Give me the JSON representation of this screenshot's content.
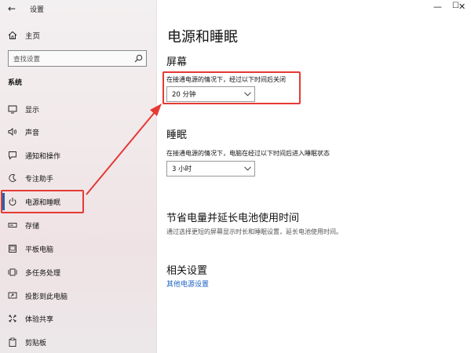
{
  "window": {
    "back": "←",
    "title": "设置",
    "controls": [
      "—",
      "☐",
      "✕"
    ]
  },
  "sidebar": {
    "home_label": "主页",
    "search_placeholder": "查找设置",
    "section_label": "系统",
    "items": [
      {
        "label": "显示",
        "icon": "display-icon"
      },
      {
        "label": "声音",
        "icon": "sound-icon"
      },
      {
        "label": "通知和操作",
        "icon": "notifications-icon"
      },
      {
        "label": "专注助手",
        "icon": "focus-assist-icon"
      },
      {
        "label": "电源和睡眠",
        "icon": "power-icon",
        "active": true
      },
      {
        "label": "存储",
        "icon": "storage-icon"
      },
      {
        "label": "平板电脑",
        "icon": "tablet-icon"
      },
      {
        "label": "多任务处理",
        "icon": "multitasking-icon"
      },
      {
        "label": "投影到此电脑",
        "icon": "project-icon"
      },
      {
        "label": "体验共享",
        "icon": "shared-experiences-icon"
      },
      {
        "label": "剪贴板",
        "icon": "clipboard-icon"
      }
    ]
  },
  "main": {
    "title": "电源和睡眠",
    "screen": {
      "heading": "屏幕",
      "desc": "在接通电源的情况下，经过以下时间后关闭",
      "value": "20 分钟"
    },
    "sleep": {
      "heading": "睡眠",
      "desc": "在接通电源的情况下，电脑在经过以下时间后进入睡眠状态",
      "value": "3 小时"
    },
    "battery": {
      "heading": "节省电量并延长电池使用时间",
      "desc": "通过选择更短的屏幕显示时长和睡眠设置，延长电池使用时间。"
    },
    "related": {
      "heading": "相关设置",
      "link": "其他电源设置"
    }
  },
  "colors": {
    "accent": "#1f5fb0",
    "highlight": "#e53935",
    "link": "#1e63c4"
  }
}
